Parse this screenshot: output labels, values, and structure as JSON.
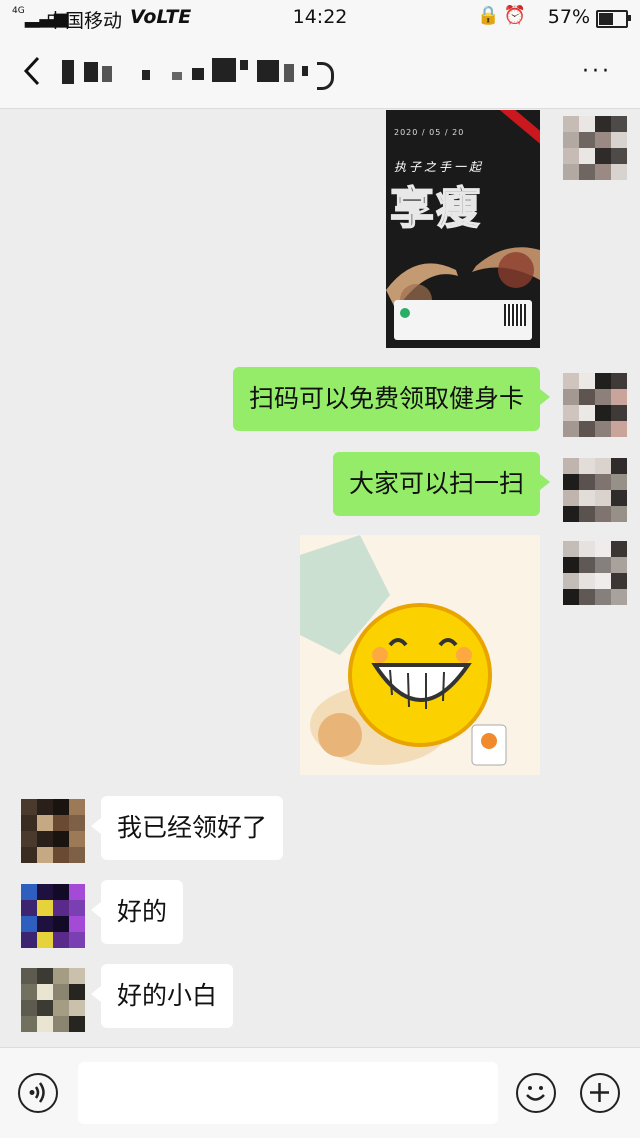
{
  "status_bar": {
    "network": "4G",
    "carrier": "中国移动",
    "volte": "VoLTE",
    "time": "14:22",
    "battery": "57%",
    "battery_level": 0.57
  },
  "header": {
    "back_icon": "chevron-left-icon",
    "more_label": "···"
  },
  "messages": [
    {
      "side": "right",
      "type": "image",
      "image": "poster"
    },
    {
      "side": "right",
      "type": "text",
      "text": "扫码可以免费领取健身卡"
    },
    {
      "side": "right",
      "type": "text",
      "text": "大家可以扫一扫"
    },
    {
      "side": "right",
      "type": "image",
      "image": "smiley-sticker"
    },
    {
      "side": "left",
      "type": "text",
      "text": "我已经领好了"
    },
    {
      "side": "left",
      "type": "text",
      "text": "好的"
    },
    {
      "side": "left",
      "type": "text",
      "text": "好的小白"
    }
  ],
  "poster": {
    "date": "2020 / 05 / 20",
    "slogan": "执子之手一起",
    "headline": "享瘦"
  },
  "input_bar": {
    "voice_icon": "voice-icon",
    "emoji_icon": "emoji-icon",
    "plus_icon": "plus-icon"
  },
  "colors": {
    "my_bubble": "#95ec69",
    "their_bubble": "#ffffff",
    "background": "#ededed"
  }
}
